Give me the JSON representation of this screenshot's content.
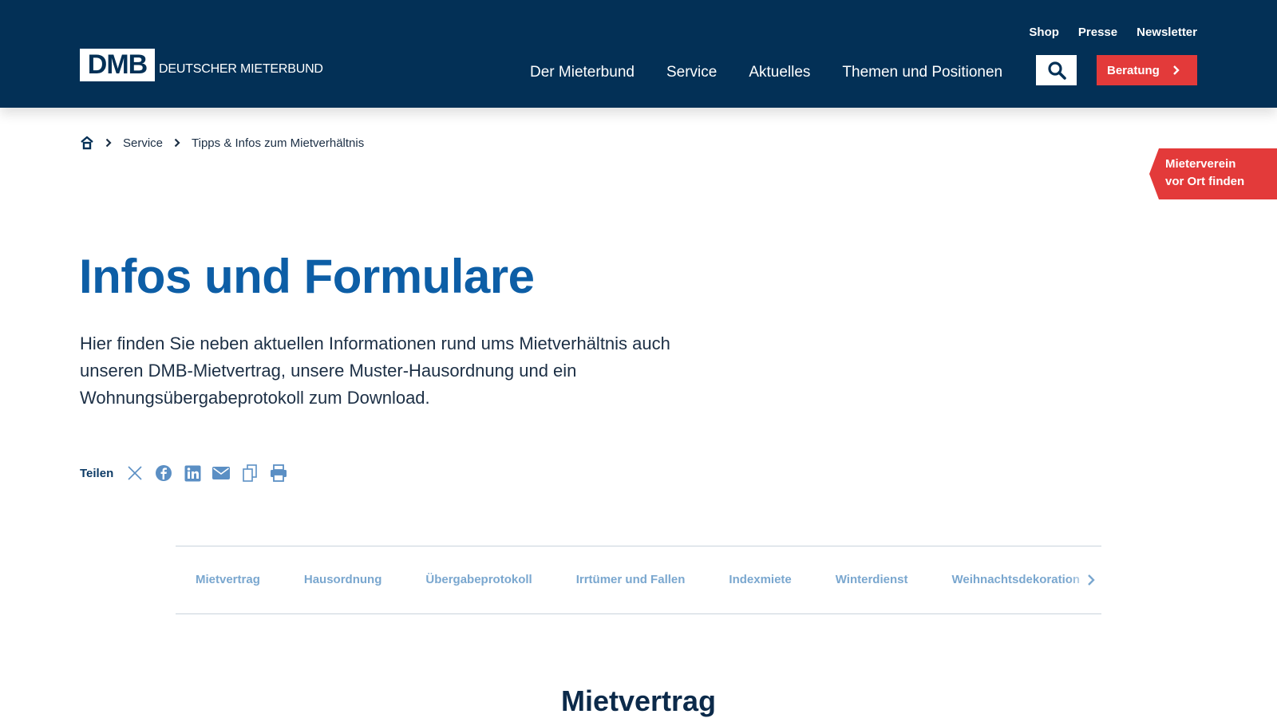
{
  "header": {
    "logo_mark": "DMB",
    "logo_text": "DEUTSCHER MIETERBUND",
    "meta_nav": [
      "Shop",
      "Presse",
      "Newsletter"
    ],
    "main_nav": [
      "Der Mieterbund",
      "Service",
      "Aktuelles",
      "Themen und Positionen"
    ],
    "cta_label": "Beratung",
    "search_icon": "search-icon"
  },
  "breadcrumb": {
    "home_icon": "home-icon",
    "items": [
      "Service",
      "Tipps & Infos zum Mietverhältnis"
    ]
  },
  "side_tab": {
    "line1": "Mieterverein",
    "line2": "vor Ort finden"
  },
  "hero": {
    "title": "Infos und Formulare",
    "lead": "Hier finden Sie neben aktuellen Informationen rund ums Mietverhältnis auch unseren DMB-Mietvertrag, unsere Muster-Hausordnung und ein Wohnungsübergabeprotokoll zum Download."
  },
  "share": {
    "label": "Teilen",
    "icons": [
      "x-icon",
      "facebook-icon",
      "linkedin-icon",
      "mail-icon",
      "copy-icon",
      "print-icon"
    ]
  },
  "tabs": {
    "items": [
      "Mietvertrag",
      "Hausordnung",
      "Übergabeprotokoll",
      "Irrtümer und Fallen",
      "Indexmiete",
      "Winterdienst",
      "Weihnachtsdekoration"
    ]
  },
  "section": {
    "title": "Mietvertrag"
  },
  "colors": {
    "header_bg": "#033056",
    "accent_red": "#e33a3a",
    "title_blue": "#0d5ea6",
    "tab_blue": "#7aa7cf"
  }
}
